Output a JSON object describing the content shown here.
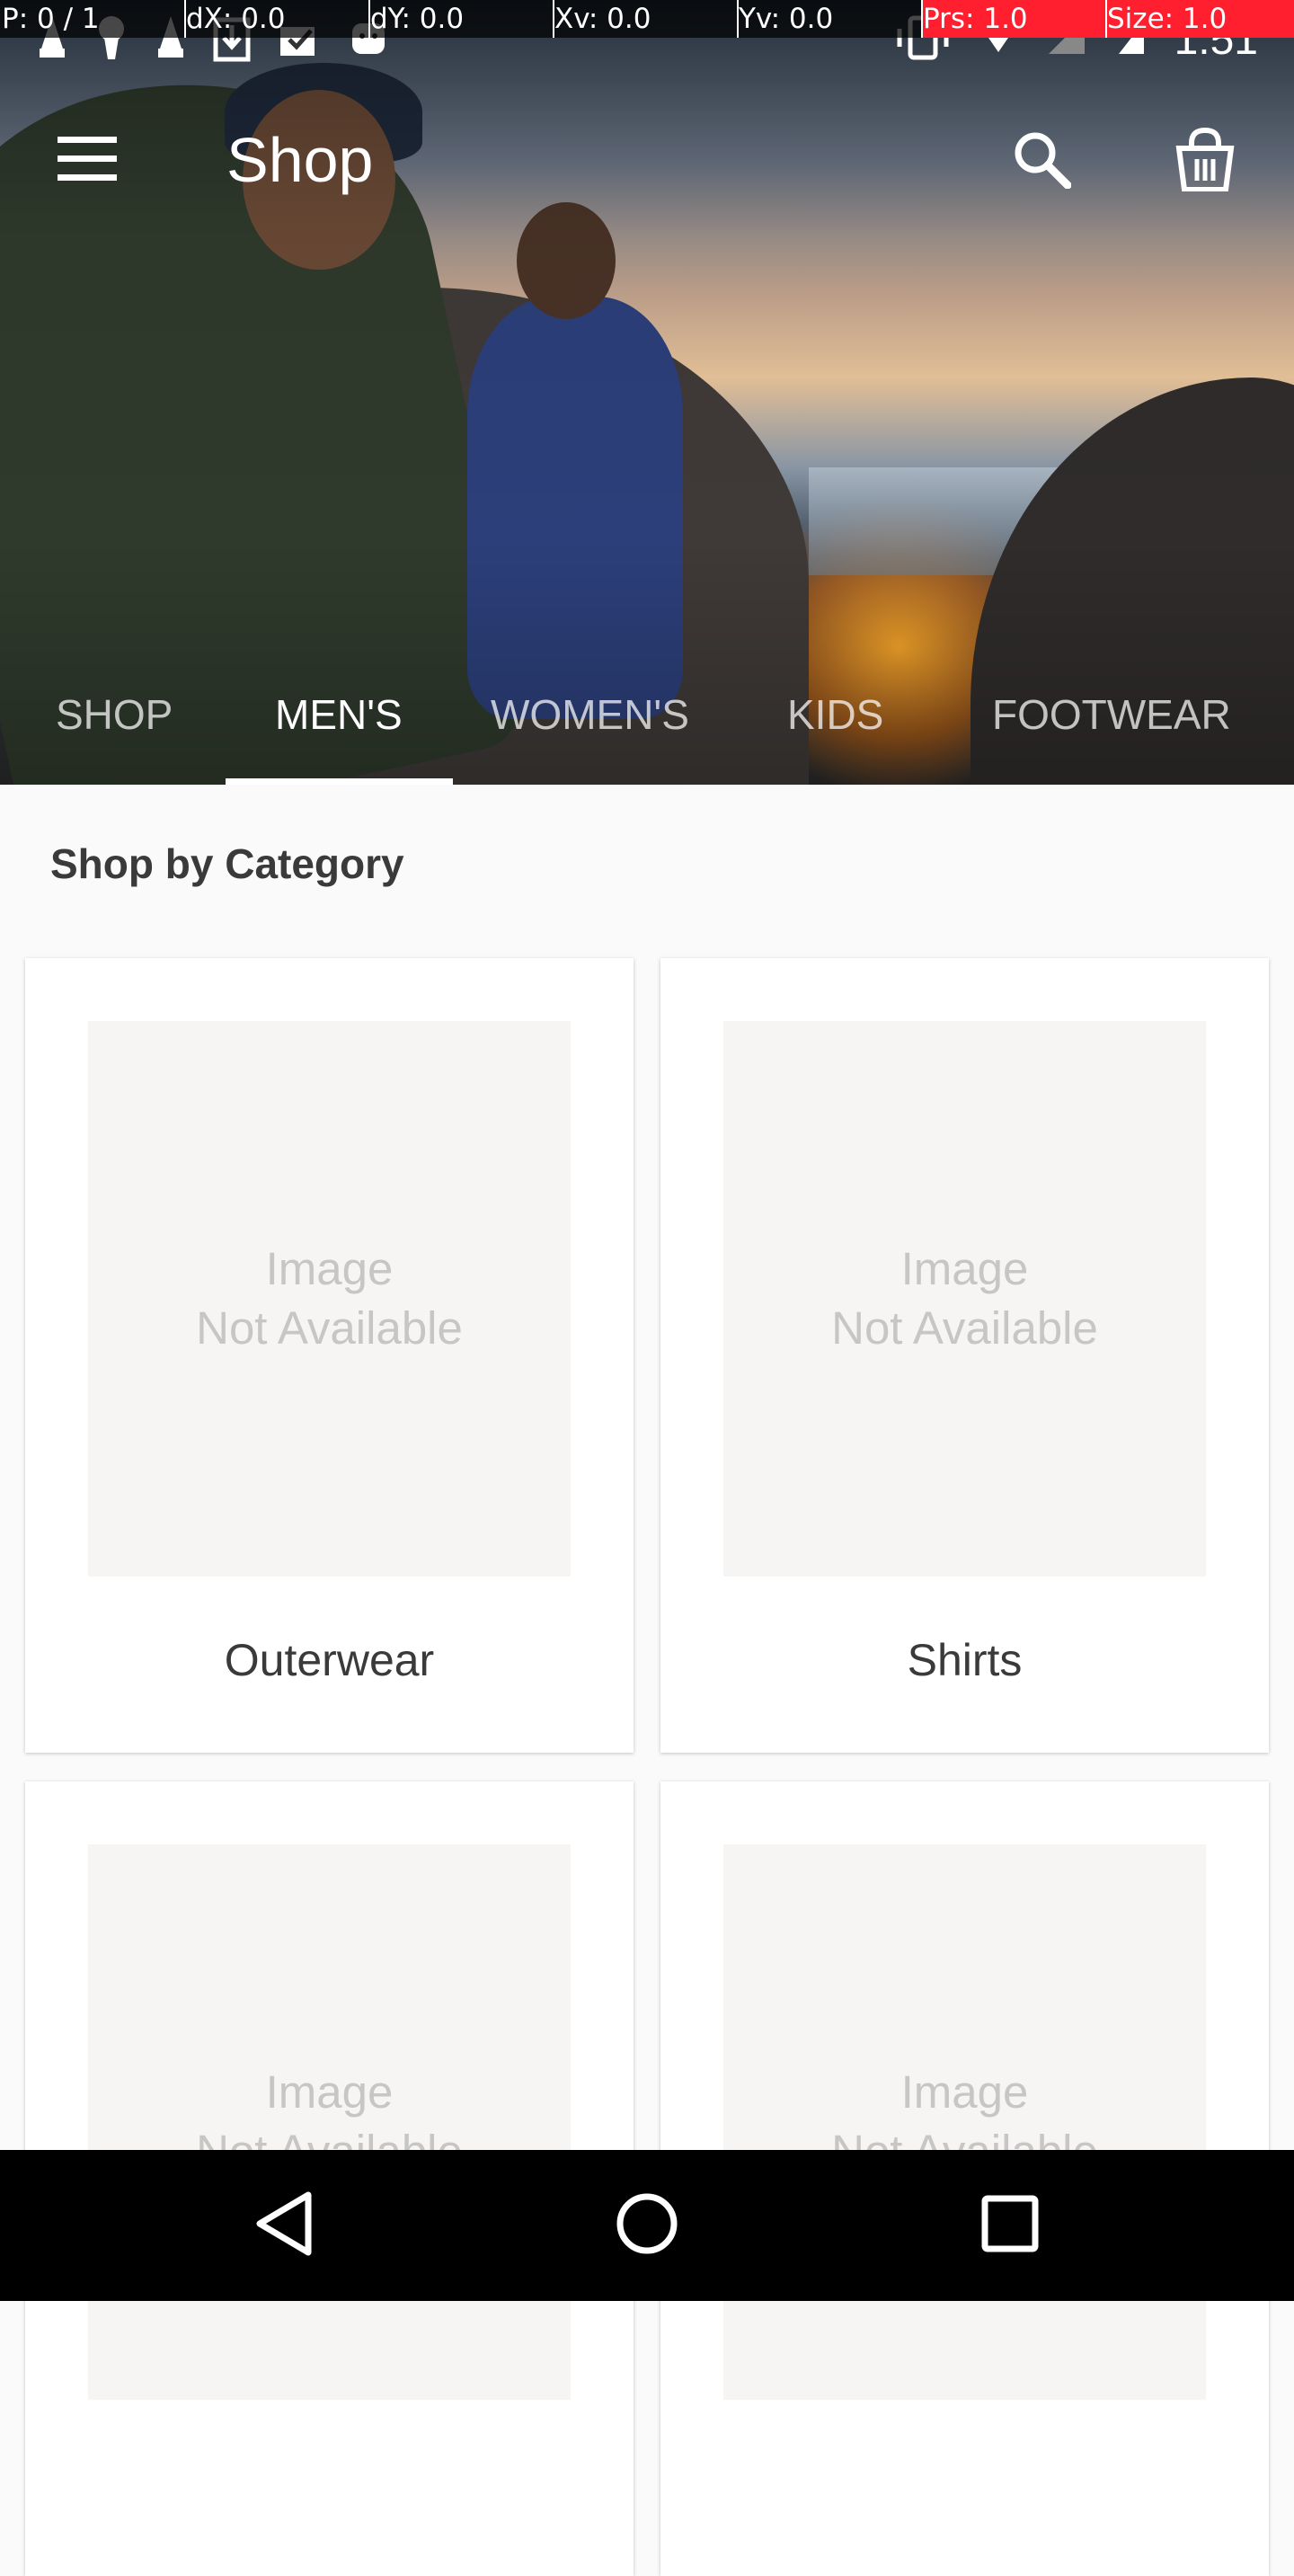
{
  "debug": {
    "pointer": "P: 0 / 1",
    "dx": "dX: 0.0",
    "dy": "dY: 0.0",
    "xv": "Xv: 0.0",
    "yv": "Yv: 0.0",
    "prs": "Prs: 1.0",
    "size": "Size: 1.0"
  },
  "status_bar": {
    "time": "1:51"
  },
  "app_bar": {
    "title": "Shop"
  },
  "tabs": [
    {
      "label": "SHOP"
    },
    {
      "label": "MEN'S"
    },
    {
      "label": "WOMEN'S"
    },
    {
      "label": "KIDS"
    },
    {
      "label": "FOOTWEAR"
    }
  ],
  "active_tab": "MEN'S",
  "section": {
    "title": "Shop by Category"
  },
  "categories": [
    {
      "label": "Outerwear",
      "placeholder": "Image\nNot Available"
    },
    {
      "label": "Shirts",
      "placeholder": "Image\nNot Available"
    },
    {
      "label": "",
      "placeholder": "Image\nNot Available"
    },
    {
      "label": "",
      "placeholder": "Image\nNot Available"
    }
  ],
  "icons": {
    "menu": "menu-icon",
    "search": "search-icon",
    "cart": "shopping-bag-icon",
    "back": "back-triangle-icon",
    "home": "home-circle-icon",
    "recents": "recents-square-icon"
  },
  "colors": {
    "debug_highlight": "#ff1f2e",
    "tab_active": "#ffffff",
    "placeholder_bg": "#f6f5f4",
    "placeholder_text": "#c7c6c5"
  }
}
